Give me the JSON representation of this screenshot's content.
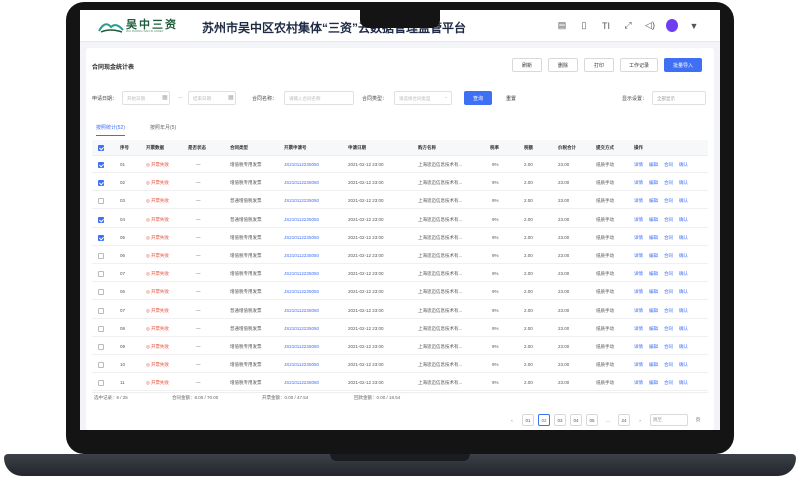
{
  "header": {
    "logo_text": "吴中三资",
    "logo_subtitle": "WU ZHONG SAN ZI ASSET",
    "title": "苏州市吴中区农村集体“三资”云数据管理监管平台",
    "icons": [
      "doc-icon",
      "file-icon",
      "text-size-icon",
      "fullscreen-icon",
      "volume-icon",
      "avatar",
      "caret-down-icon"
    ],
    "text_size_label": "TI"
  },
  "page": {
    "title": "合同现金统计表",
    "actions": [
      "刷新",
      "删除",
      "打印",
      "工作记录",
      "批量导入"
    ]
  },
  "filters": {
    "date_label": "申请日期：",
    "date_start_placeholder": "开始日期",
    "date_sep": "—",
    "date_end_placeholder": "结束日期",
    "name_label": "合同名称：",
    "name_placeholder": "请输入合同名称",
    "type_label": "合同类型：",
    "type_placeholder": "请选择合同类型",
    "query_button": "查询",
    "reset_button": "重置",
    "display_label": "显示设置：",
    "display_value": "全部显示"
  },
  "tabs": [
    "按照统计(52)",
    "按照年月(5)"
  ],
  "table": {
    "columns": [
      "",
      "序号",
      "开票数据",
      "是否状态",
      "合同类型",
      "开票申请号",
      "申请日期",
      "购方名称",
      "税率",
      "税额",
      "价税合计",
      "提交方式",
      "操作"
    ],
    "rows": [
      {
        "checked": true,
        "no": "01",
        "status": "开票失败",
        "flag": "—",
        "type": "增值税专用发票",
        "code": "JS210112235050",
        "date": "2021-02-12 23:00",
        "buyer": "上海思迈信息技术有...",
        "rate": "9%",
        "tax": "2.00",
        "total": "23.00",
        "method": "纸质手动"
      },
      {
        "checked": true,
        "no": "02",
        "status": "开票失败",
        "flag": "—",
        "type": "增值税专用发票",
        "code": "JS210112235050",
        "date": "2021-02-12 23:00",
        "buyer": "上海思迈信息技术有...",
        "rate": "9%",
        "tax": "2.00",
        "total": "23.00",
        "method": "纸质手动"
      },
      {
        "checked": false,
        "no": "03",
        "status": "开票失败",
        "flag": "—",
        "type": "普通增值税发票",
        "code": "JS210112235050",
        "date": "2021-02-12 23:00",
        "buyer": "上海思迈信息技术有...",
        "rate": "9%",
        "tax": "2.00",
        "total": "23.00",
        "method": "纸质手动"
      },
      {
        "checked": true,
        "no": "04",
        "status": "开票失败",
        "flag": "—",
        "type": "普通增值税发票",
        "code": "JS210112235050",
        "date": "2021-02-12 23:00",
        "buyer": "上海思迈信息技术有...",
        "rate": "9%",
        "tax": "2.00",
        "total": "23.00",
        "method": "纸质手动"
      },
      {
        "checked": true,
        "no": "05",
        "status": "开票失败",
        "flag": "—",
        "type": "增值税专用发票",
        "code": "JS210112235050",
        "date": "2021-02-12 23:00",
        "buyer": "上海思迈信息技术有...",
        "rate": "9%",
        "tax": "2.00",
        "total": "23.00",
        "method": "纸质手动"
      },
      {
        "checked": false,
        "no": "06",
        "status": "开票失败",
        "flag": "—",
        "type": "增值税专用发票",
        "code": "JS210112235050",
        "date": "2021-02-12 23:00",
        "buyer": "上海思迈信息技术有...",
        "rate": "9%",
        "tax": "2.00",
        "total": "23.00",
        "method": "纸质手动"
      },
      {
        "checked": false,
        "no": "07",
        "status": "开票失败",
        "flag": "—",
        "type": "增值税专用发票",
        "code": "JS210112235050",
        "date": "2021-02-12 23:00",
        "buyer": "上海思迈信息技术有...",
        "rate": "9%",
        "tax": "2.00",
        "total": "23.00",
        "method": "纸质手动"
      },
      {
        "checked": false,
        "no": "06",
        "status": "开票失败",
        "flag": "—",
        "type": "增值税专用发票",
        "code": "JS210112235050",
        "date": "2021-02-12 23:00",
        "buyer": "上海思迈信息技术有...",
        "rate": "9%",
        "tax": "2.00",
        "total": "23.00",
        "method": "纸质手动"
      },
      {
        "checked": false,
        "no": "07",
        "status": "开票失败",
        "flag": "—",
        "type": "普通增值税发票",
        "code": "JS210112235050",
        "date": "2021-02-12 23:00",
        "buyer": "上海思迈信息技术有...",
        "rate": "9%",
        "tax": "2.00",
        "total": "23.00",
        "method": "纸质手动"
      },
      {
        "checked": false,
        "no": "08",
        "status": "开票失败",
        "flag": "—",
        "type": "普通增值税发票",
        "code": "JS210112235050",
        "date": "2021-02-12 23:00",
        "buyer": "上海思迈信息技术有...",
        "rate": "9%",
        "tax": "2.00",
        "total": "23.00",
        "method": "纸质手动"
      },
      {
        "checked": false,
        "no": "09",
        "status": "开票失败",
        "flag": "—",
        "type": "增值税专用发票",
        "code": "JS210112235050",
        "date": "2021-02-12 23:00",
        "buyer": "上海思迈信息技术有...",
        "rate": "9%",
        "tax": "2.00",
        "total": "23.00",
        "method": "纸质手动"
      },
      {
        "checked": false,
        "no": "10",
        "status": "开票失败",
        "flag": "—",
        "type": "增值税专用发票",
        "code": "JS210112235050",
        "date": "2021-02-12 23:00",
        "buyer": "上海思迈信息技术有...",
        "rate": "9%",
        "tax": "2.00",
        "total": "23.00",
        "method": "纸质手动"
      },
      {
        "checked": false,
        "no": "11",
        "status": "开票失败",
        "flag": "—",
        "type": "增值税专用发票",
        "code": "JS210112235050",
        "date": "2021-02-12 23:00",
        "buyer": "上海思迈信息技术有...",
        "rate": "9%",
        "tax": "2.00",
        "total": "23.00",
        "method": "纸质手动"
      }
    ],
    "ops": [
      "详情",
      "编辑",
      "合同",
      "确认"
    ]
  },
  "summary": {
    "selected": "选中记录：6 / 25",
    "contract_amount": "合同金额：8.00 / 70.00",
    "invoiced_amount": "开票金额：0.00 / 47.54",
    "received_amount": "回款金额：0.00 / 18.54"
  },
  "pager": {
    "prev": "‹",
    "pages": [
      "01",
      "02",
      "03",
      "04",
      "05"
    ],
    "active_page": "02",
    "ellipsis": "...",
    "last": "24",
    "next": "›",
    "jump_label": "跳至",
    "page_unit": "页"
  },
  "colors": {
    "primary": "#3f6ff5",
    "danger": "#e0543b",
    "brand_green": "#1d5b3a"
  }
}
